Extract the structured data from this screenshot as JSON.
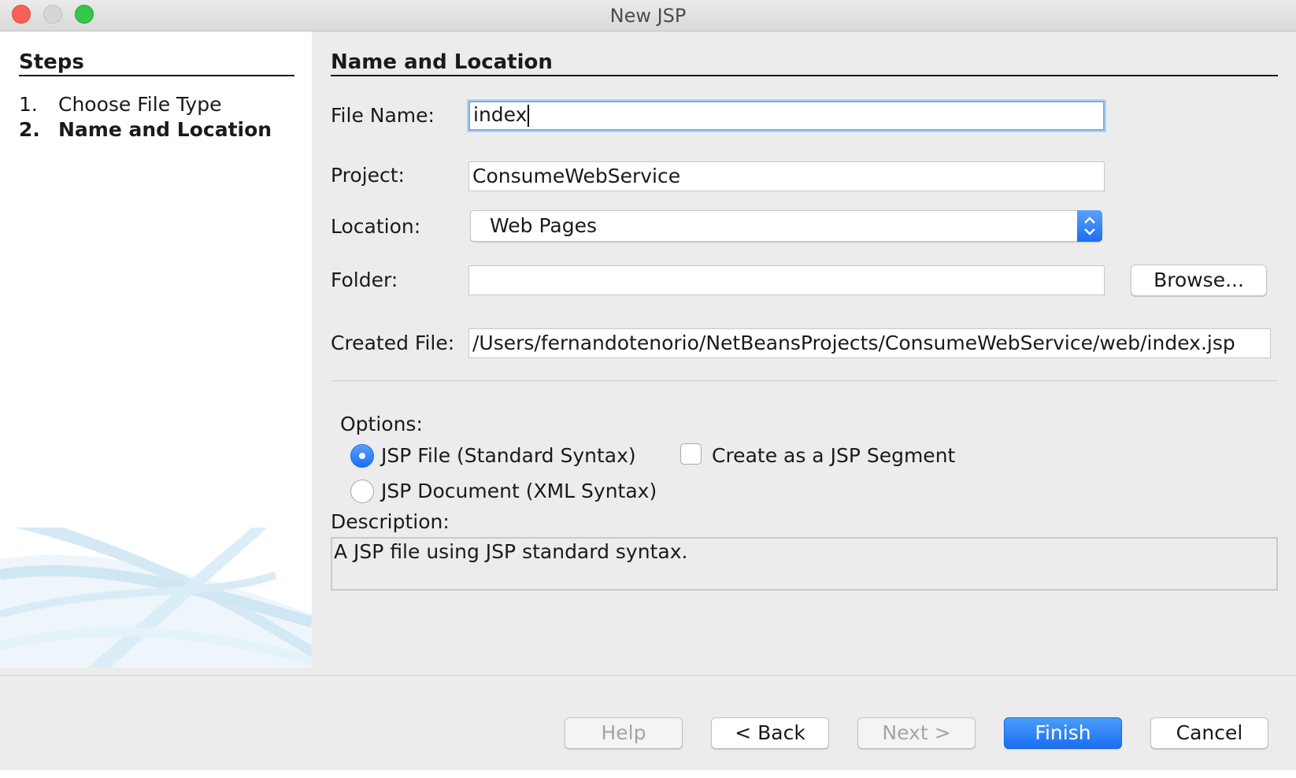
{
  "window": {
    "title": "New JSP"
  },
  "steps": {
    "heading": "Steps",
    "items": [
      {
        "num": "1.",
        "label": "Choose File Type"
      },
      {
        "num": "2.",
        "label": "Name and Location"
      }
    ]
  },
  "main": {
    "heading": "Name and Location",
    "file_name": {
      "label": "File Name:",
      "value": "index"
    },
    "project": {
      "label": "Project:",
      "value": "ConsumeWebService"
    },
    "location": {
      "label": "Location:",
      "value": "Web Pages"
    },
    "folder": {
      "label": "Folder:",
      "value": "",
      "browse_label": "Browse..."
    },
    "created_file": {
      "label": "Created File:",
      "value": "/Users/fernandotenorio/NetBeansProjects/ConsumeWebService/web/index.jsp"
    },
    "options": {
      "label": "Options:",
      "radio_standard": "JSP File (Standard Syntax)",
      "radio_xml": "JSP Document (XML Syntax)",
      "segment_checkbox": "Create as a JSP Segment",
      "selected": "JSP File (Standard Syntax)",
      "segment_checked": false
    },
    "description": {
      "label": "Description:",
      "text": "A JSP file using JSP standard syntax."
    }
  },
  "buttons": {
    "help": "Help",
    "back": "< Back",
    "next": "Next >",
    "finish": "Finish",
    "cancel": "Cancel"
  },
  "colors": {
    "accent": "#1a6ef3",
    "focus_ring": "#7aaee4"
  }
}
